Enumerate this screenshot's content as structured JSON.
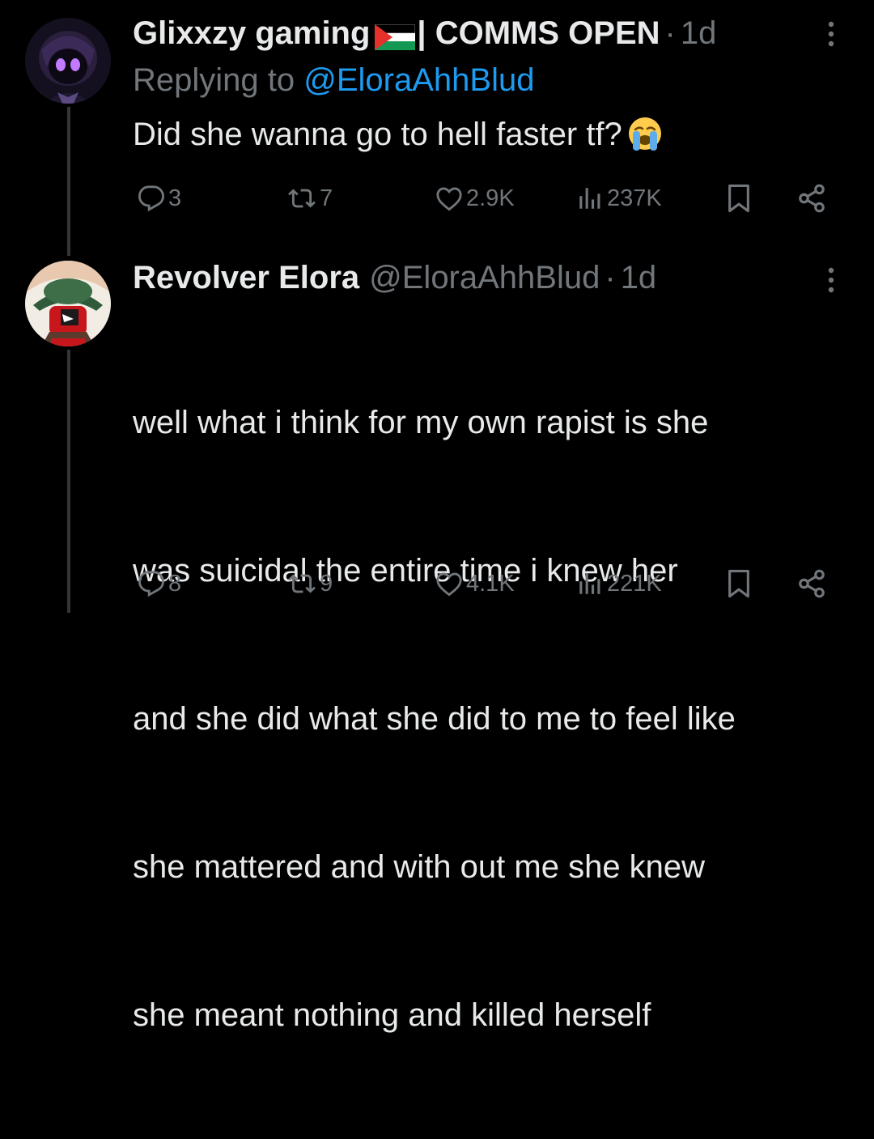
{
  "tweets": [
    {
      "display_name": "Glixxzy gaming",
      "flag": "palestine-flag",
      "name_suffix": "| COMMS OPEN",
      "separator": "·",
      "time": "1d",
      "replying_prefix": "Replying to",
      "replying_to": "@EloraAhhBlud",
      "text": "Did she wanna go to hell faster tf?",
      "emoji": "loudly-crying-face",
      "replies": "3",
      "reposts": "7",
      "likes": "2.9K",
      "views": "237K"
    },
    {
      "display_name": "Revolver Elora",
      "handle": "@EloraAhhBlud",
      "separator": "·",
      "time": "1d",
      "text_lines": [
        "well what i think for my own rapist is she",
        "was suicidal the entire time i knew her",
        "and she did what she did to me to feel like",
        "she mattered and with out me she knew",
        "she meant nothing and killed herself"
      ],
      "replies": "8",
      "reposts": "9",
      "likes": "4.1K",
      "views": "221K"
    }
  ],
  "colors": {
    "background": "#000000",
    "text": "#e7e9ea",
    "muted": "#71767b",
    "link": "#1d9bf0",
    "thread_line": "#333639"
  },
  "icons": {
    "reply": "reply-icon",
    "repost": "repost-icon",
    "like": "heart-icon",
    "views": "views-bar-chart-icon",
    "bookmark": "bookmark-icon",
    "share": "share-icon",
    "more": "more-vertical-icon"
  }
}
